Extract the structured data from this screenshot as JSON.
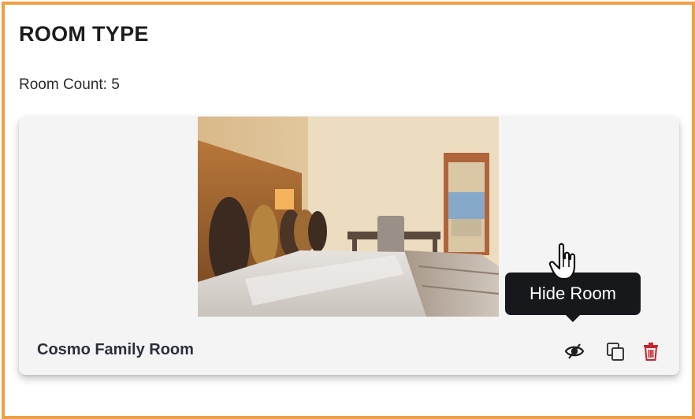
{
  "page": {
    "title": "ROOM TYPE"
  },
  "summary": {
    "room_count_text": "Room Count: 5"
  },
  "room_card": {
    "name": "Cosmo Family Room",
    "actions": {
      "hide_tooltip": "Hide Room"
    },
    "icons": {
      "toggle_visibility": "eye-icon",
      "duplicate": "copy-icon",
      "delete": "trash-icon"
    }
  },
  "colors": {
    "frame_border": "#f0a044",
    "delete_icon": "#c8232c",
    "tooltip_bg": "#16181c"
  }
}
